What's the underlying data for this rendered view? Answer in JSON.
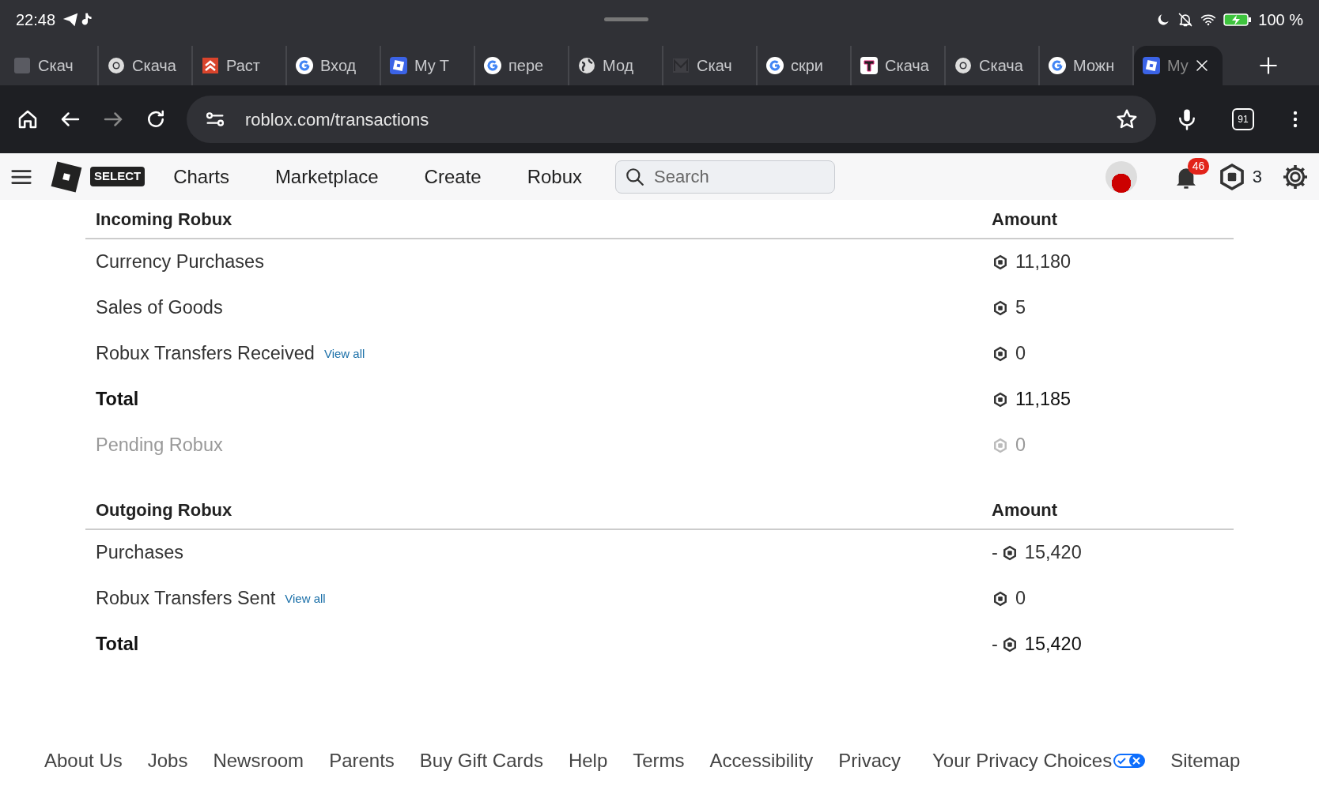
{
  "status_bar": {
    "time": "22:48",
    "battery": "100 %"
  },
  "tabs": [
    {
      "label": "Скач",
      "kind": "blank",
      "selected": false
    },
    {
      "label": "Скача",
      "kind": "chrome",
      "selected": false
    },
    {
      "label": "Раст",
      "kind": "chevrons",
      "selected": false
    },
    {
      "label": "Вход",
      "kind": "google",
      "selected": false
    },
    {
      "label": "My T",
      "kind": "roblox",
      "selected": false
    },
    {
      "label": "пере",
      "kind": "google",
      "selected": false
    },
    {
      "label": "Мод",
      "kind": "globe",
      "selected": false
    },
    {
      "label": "Скач",
      "kind": "dark",
      "selected": false
    },
    {
      "label": "скри",
      "kind": "google",
      "selected": false
    },
    {
      "label": "Скача",
      "kind": "tbox",
      "selected": false
    },
    {
      "label": "Скача",
      "kind": "chrome",
      "selected": false
    },
    {
      "label": "Можн",
      "kind": "google",
      "selected": false
    },
    {
      "label": "My",
      "kind": "roblox",
      "selected": true
    }
  ],
  "tab_count": "91",
  "address_bar": {
    "url": "roblox.com/transactions"
  },
  "navbar": {
    "badge": "SELECT",
    "links": [
      "Charts",
      "Marketplace",
      "Create",
      "Robux"
    ],
    "search": {
      "placeholder": "Search"
    },
    "notifications": "46",
    "robux": "3"
  },
  "sections": [
    {
      "title": "Incoming Robux",
      "amount_heading": "Amount",
      "rows": [
        {
          "label": "Currency Purchases",
          "kind": "normal",
          "amount": "11,180"
        },
        {
          "label": "Sales of Goods",
          "kind": "normal",
          "amount": "5"
        },
        {
          "label": "Robux Transfers Received",
          "kind": "normal",
          "link": "View all",
          "amount": "0"
        },
        {
          "label": "Total",
          "kind": "total",
          "amount": "11,185"
        },
        {
          "label": "Pending Robux",
          "kind": "pending",
          "amount": "0"
        }
      ]
    },
    {
      "title": "Outgoing Robux",
      "amount_heading": "Amount",
      "rows": [
        {
          "label": "Purchases",
          "kind": "normal",
          "sign": "-",
          "amount": "15,420"
        },
        {
          "label": "Robux Transfers Sent",
          "kind": "normal",
          "link": "View all",
          "amount": "0"
        },
        {
          "label": "Total",
          "kind": "total",
          "sign": "-",
          "amount": "15,420"
        }
      ]
    }
  ],
  "footer": [
    "About Us",
    "Jobs",
    "Newsroom",
    "Parents",
    "Buy Gift Cards",
    "Help",
    "Terms",
    "Accessibility",
    "Privacy",
    "Your Privacy Choices",
    "Sitemap"
  ]
}
